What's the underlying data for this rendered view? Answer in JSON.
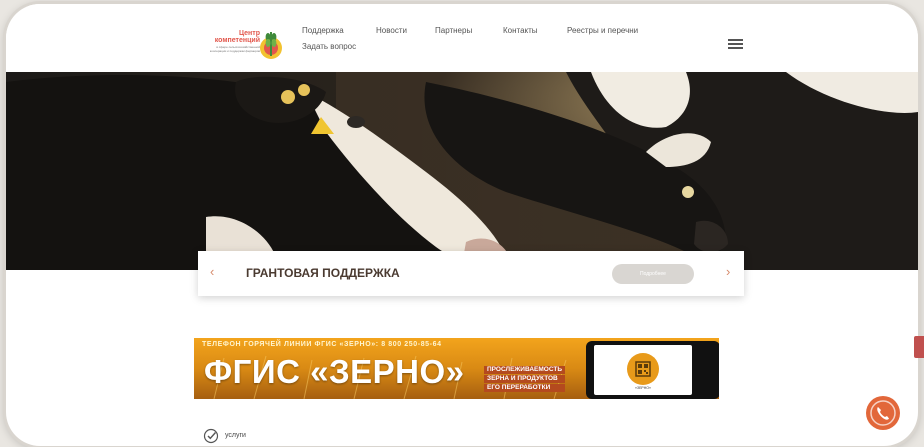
{
  "header": {
    "logo_title": "Центр компетенций",
    "logo_subtitle": "в сфере сельскохозяйственной кооперации и поддержки фермеров",
    "nav": [
      {
        "label": "Поддержка"
      },
      {
        "label": "Новости"
      },
      {
        "label": "Партнеры"
      },
      {
        "label": "Контакты"
      },
      {
        "label": "Реестры и перечни"
      }
    ],
    "ask_question": "Задать вопрос"
  },
  "slider": {
    "title": "ГРАНТОВАЯ ПОДДЕРЖКА",
    "button_label": "Подробнее",
    "prev_icon": "chevron-left-icon",
    "next_icon": "chevron-right-icon"
  },
  "banner": {
    "hotline": "ТЕЛЕФОН ГОРЯЧЕЙ ЛИНИИ ФГИС «ЗЕРНО»: 8 800 250-85-64",
    "title": "ФГИС «ЗЕРНО»",
    "lines": [
      "ПРОСЛЕЖИВАЕМОСТЬ",
      "ЗЕРНА И ПРОДУКТОВ",
      "ЕГО ПЕРЕРАБОТКИ"
    ],
    "phone_label": "«ЗЕРНО»"
  },
  "services": {
    "label": "услуги",
    "icon": "checkmark-circle-icon"
  },
  "call_button": {
    "icon": "phone-icon"
  },
  "colors": {
    "accent": "#e2673a",
    "logo_red": "#e2574c",
    "banner_brown": "#b44a1e"
  }
}
